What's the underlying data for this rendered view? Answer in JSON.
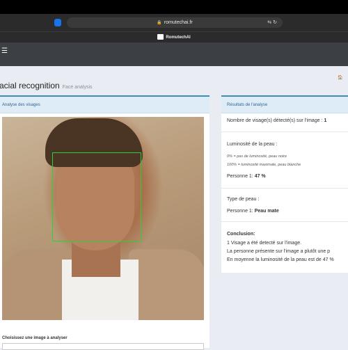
{
  "browser": {
    "url": "romutechai.fr",
    "tab_title": "RomutechAI"
  },
  "page": {
    "title": "acial recognition",
    "subtitle": "Face analysis"
  },
  "left_panel": {
    "header": "Analyse des visages",
    "choose_label": "Choisissez une image à analyser"
  },
  "right_panel": {
    "header": "Résultats de l'analyse",
    "faces_count_label": "Nombre de visage(s) détecté(s) sur l'image :",
    "faces_count_value": "1",
    "luminosity_title": "Luminosité de la peau :",
    "luminosity_scale_min": "0% = pas de luminosité, peau noire",
    "luminosity_scale_max": "100% = luminosité maximale, peau blanche",
    "luminosity_person_label": "Personne 1:",
    "luminosity_person_value": "47 %",
    "skin_type_title": "Type de peau :",
    "skin_person_label": "Personne 1:",
    "skin_person_value": "Peau mate",
    "conclusion_title": "Conclusion:",
    "conclusion_line1": "1 Visage a été detecté sur l'image.",
    "conclusion_line2": "La personne présente sur l'image a plutôt une p",
    "conclusion_line3": "En moyenne la luminosité de la peau est de 47 %"
  },
  "icons": {
    "shield": "shield-icon",
    "lock": "lock-icon",
    "translate": "translate-icon",
    "reload": "reload-icon",
    "menu": "hamburger-menu-icon",
    "home": "home-icon"
  },
  "colors": {
    "accent": "#3c8dbc",
    "navbar": "#3c3f44",
    "facebox": "#27d33a"
  }
}
